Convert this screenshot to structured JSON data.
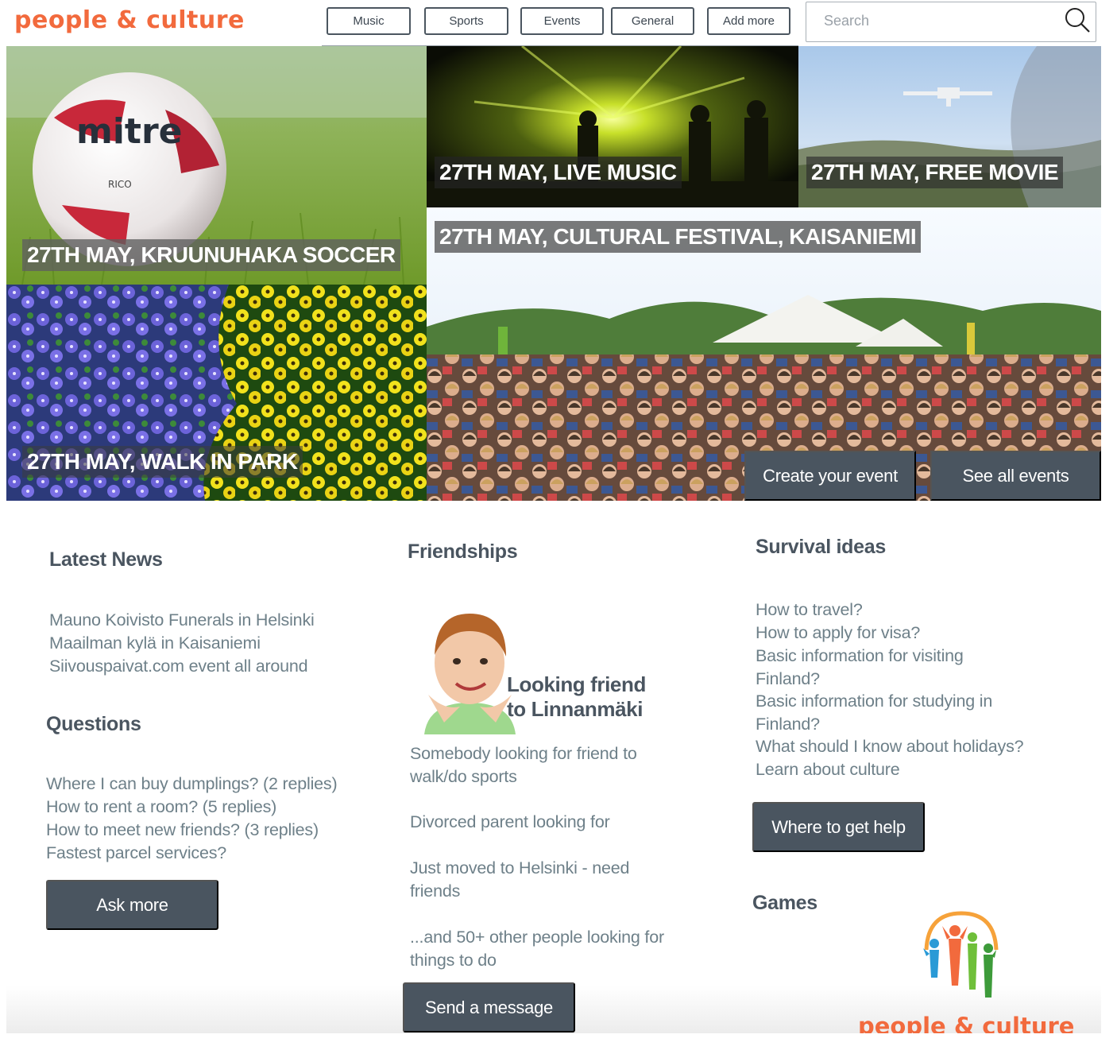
{
  "header": {
    "logo": "people & culture",
    "categories": [
      "Music",
      "Sports",
      "Events",
      "General",
      "Add more"
    ],
    "search_placeholder": "Search"
  },
  "events": {
    "soccer": "27TH MAY, KRUUNUHAKA SOCCER",
    "music": "27TH MAY,  LIVE MUSIC",
    "movie": "27TH MAY,  FREE MOVIE",
    "festival": "27TH MAY,  CULTURAL FESTIVAL, KAISANIEMI",
    "park": "27TH MAY,  WALK IN PARK",
    "ball_brand": "mitre",
    "ball_model": "RICO",
    "create_button": "Create your event",
    "see_all_button": "See all events"
  },
  "news": {
    "title": "Latest News",
    "items": [
      "Mauno Koivisto Funerals in Helsinki",
      "Maailman kylä in Kaisaniemi",
      "Siivouspaivat.com event all around"
    ]
  },
  "questions": {
    "title": "Questions",
    "items": [
      "Where I can buy dumplings?  (2 replies)",
      "How to rent a room?  (5 replies)",
      "How to meet new friends? (3 replies)",
      "Fastest parcel services?"
    ],
    "button": "Ask more"
  },
  "friendships": {
    "title": "Friendships",
    "card_line1": "Looking friend",
    "card_line2": "to Linnanmäki",
    "items": [
      "Somebody looking for friend to walk/do sports",
      "Divorced parent looking for",
      "Just moved to Helsinki - need friends",
      "...and 50+ other people looking for things to do"
    ],
    "button": "Send a message"
  },
  "survival": {
    "title": "Survival ideas",
    "items": [
      "How to travel?",
      "How to apply for visa?",
      "Basic information for visiting Finland?",
      "Basic information for studying in Finland?",
      "What should I know about holidays?",
      "Learn about culture"
    ],
    "button": "Where to get help"
  },
  "games": {
    "title": "Games",
    "logo_text": "people & culture"
  },
  "colors": {
    "brand": "#f26a3d",
    "dark_button": "#4a5560",
    "link": "#6e8089",
    "caption_bg": "#5f5f5f"
  }
}
